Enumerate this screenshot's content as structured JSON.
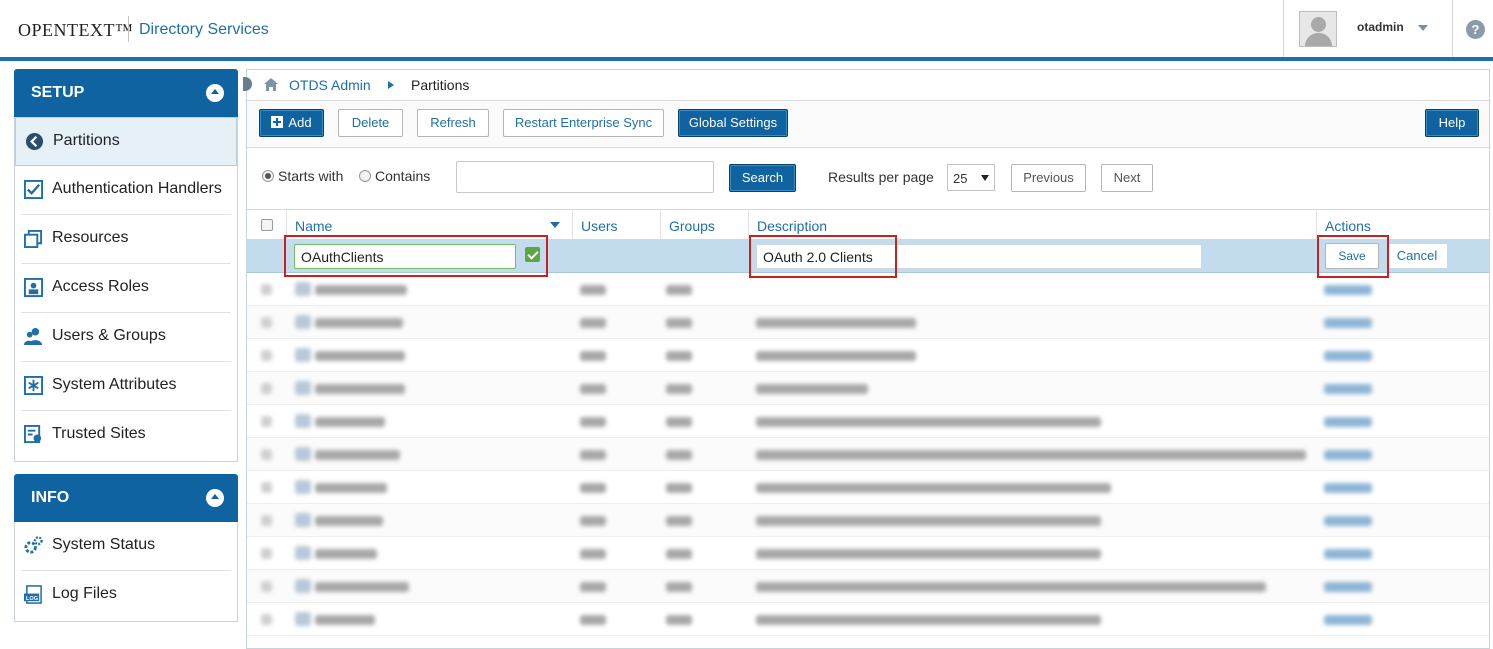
{
  "header": {
    "brand": "OPENTEXT™",
    "app_name": "Directory Services",
    "username": "otadmin",
    "help_glyph": "?"
  },
  "sidebar": {
    "setup": {
      "title": "SETUP",
      "items": [
        {
          "label": "Partitions",
          "icon": "partitions-icon",
          "active": true
        },
        {
          "label": "Authentication Handlers",
          "icon": "checkbox-icon"
        },
        {
          "label": "Resources",
          "icon": "resources-icon"
        },
        {
          "label": "Access Roles",
          "icon": "access-roles-icon"
        },
        {
          "label": "Users & Groups",
          "icon": "users-icon"
        },
        {
          "label": "System Attributes",
          "icon": "asterisk-icon"
        },
        {
          "label": "Trusted Sites",
          "icon": "trusted-sites-icon"
        }
      ]
    },
    "info": {
      "title": "INFO",
      "items": [
        {
          "label": "System Status",
          "icon": "gears-icon"
        },
        {
          "label": "Log Files",
          "icon": "log-icon"
        }
      ]
    }
  },
  "breadcrumb": {
    "root": "OTDS Admin",
    "current": "Partitions"
  },
  "toolbar": {
    "add": "Add",
    "delete": "Delete",
    "refresh": "Refresh",
    "restart_sync": "Restart Enterprise Sync",
    "global_settings": "Global Settings",
    "help": "Help"
  },
  "search": {
    "starts_with": "Starts with",
    "contains": "Contains",
    "selected_mode": "starts_with",
    "query": "",
    "button": "Search",
    "results_per_page_label": "Results per page",
    "results_per_page": "25",
    "previous": "Previous",
    "next": "Next"
  },
  "table": {
    "columns": [
      "Name",
      "Users",
      "Groups",
      "Description",
      "Actions"
    ],
    "edit_row": {
      "name": "OAuthClients",
      "description": "OAuth 2.0 Clients",
      "save": "Save",
      "cancel": "Cancel"
    },
    "blurred_rows": 11
  },
  "colors": {
    "primary": "#0f63a0",
    "link": "#1f6fa6",
    "highlight": "#c82121",
    "edit_row_bg": "#c2dcee"
  }
}
